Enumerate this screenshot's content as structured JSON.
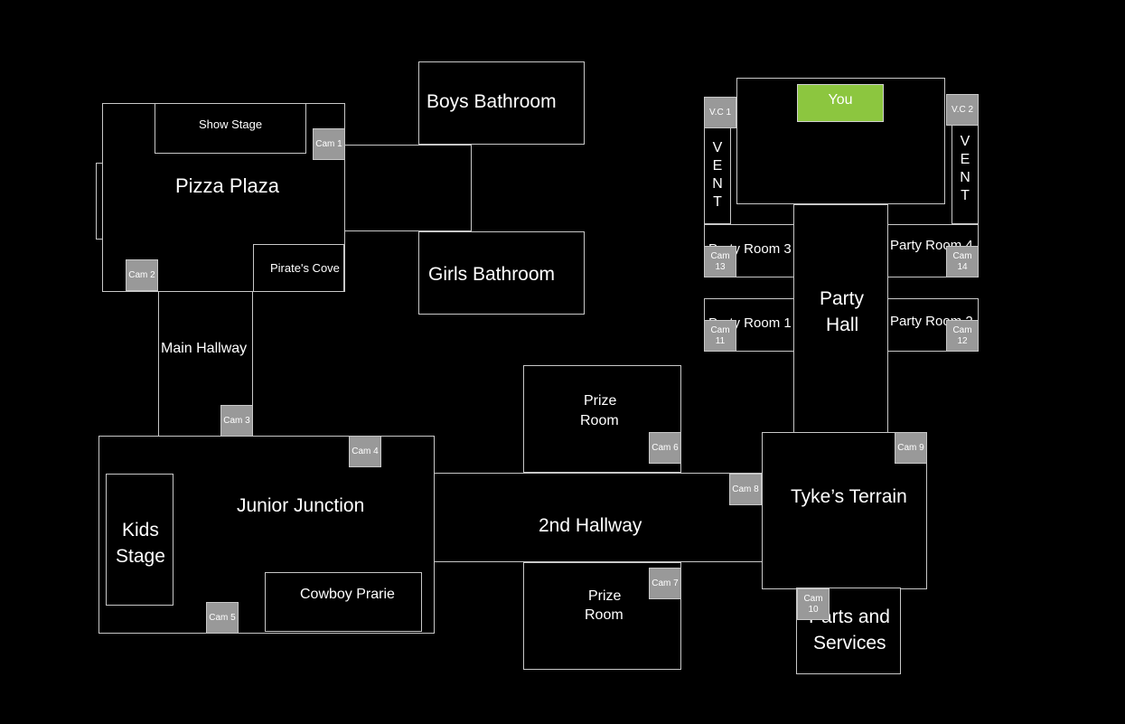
{
  "map": {
    "colors": {
      "background": "#000000",
      "wall": "#c8c8c8",
      "camera": "#999999",
      "player": "#8cc63f"
    },
    "rooms": {
      "pizza_plaza": "Pizza Plaza",
      "show_stage": "Show Stage",
      "pirates_cove": "Pirate's Cove",
      "boys_bathroom": "Boys Bathroom",
      "girls_bathroom": "Girls Bathroom",
      "main_hallway": "Main Hallway",
      "junior_junction": "Junior Junction",
      "kids_stage_line1": "Kids",
      "kids_stage_line2": "Stage",
      "cowboy_prarie": "Cowboy Prarie",
      "prize_room_top_line1": "Prize",
      "prize_room_top_line2": "Room",
      "prize_room_bottom_line1": "Prize",
      "prize_room_bottom_line2": "Room",
      "second_hallway": "2nd Hallway",
      "tykes_terrain": "Tyke’s Terrain",
      "parts_services_line1": "Parts and",
      "parts_services_line2": "Services",
      "party_hall_line1": "Party",
      "party_hall_line2": "Hall",
      "party_room_1": "Party Room 1",
      "party_room_2": "Party Room 2",
      "party_room_3": "Party Room 3",
      "party_room_4": "Party Room 4",
      "vent_left": [
        "V",
        "E",
        "N",
        "T"
      ],
      "vent_right": [
        "V",
        "E",
        "N",
        "T"
      ]
    },
    "player": "You",
    "cameras": {
      "cam1": "Cam 1",
      "cam2": "Cam 2",
      "cam3": "Cam 3",
      "cam4": "Cam 4",
      "cam5": "Cam 5",
      "cam6": "Cam 6",
      "cam7": "Cam 7",
      "cam8": "Cam 8",
      "cam9": "Cam 9",
      "cam10_line1": "Cam",
      "cam10_line2": "10",
      "cam11": "Cam 11",
      "cam12": "Cam 12",
      "cam13": "Cam 13",
      "cam14": "Cam 14",
      "vc1": "V.C 1",
      "vc2": "V.C 2"
    }
  }
}
